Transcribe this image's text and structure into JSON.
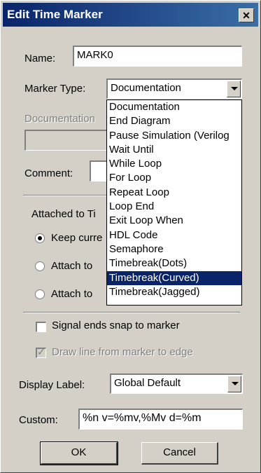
{
  "dialog": {
    "title": "Edit Time Marker",
    "close_glyph": "✕"
  },
  "name": {
    "label": "Name:",
    "value": "MARK0"
  },
  "marker_type": {
    "label": "Marker Type:",
    "value": "Documentation",
    "options": [
      "Documentation",
      "End Diagram",
      "Pause Simulation (Verilog",
      "Wait Until",
      "While Loop",
      "For Loop",
      "Repeat Loop",
      "Loop End",
      "Exit Loop When",
      "HDL Code",
      "Semaphore",
      "Timebreak(Dots)",
      "Timebreak(Curved)",
      "Timebreak(Jagged)"
    ],
    "highlighted": "Timebreak(Curved)"
  },
  "documentation": {
    "label": "Documentation"
  },
  "comment": {
    "label": "Comment:"
  },
  "attached": {
    "label": "Attached to Ti",
    "option1": "Keep curre",
    "option2": "Attach to",
    "option3": "Attach to"
  },
  "checks": {
    "snap_label": "Signal ends snap to marker",
    "draw_line_label": "Draw line from marker to edge"
  },
  "display_label": {
    "label": "Display Label:",
    "value": "Global Default"
  },
  "custom": {
    "label": "Custom:",
    "value": "%n v=%mv,%Mv d=%m"
  },
  "buttons": {
    "ok": "OK",
    "cancel": "Cancel"
  }
}
